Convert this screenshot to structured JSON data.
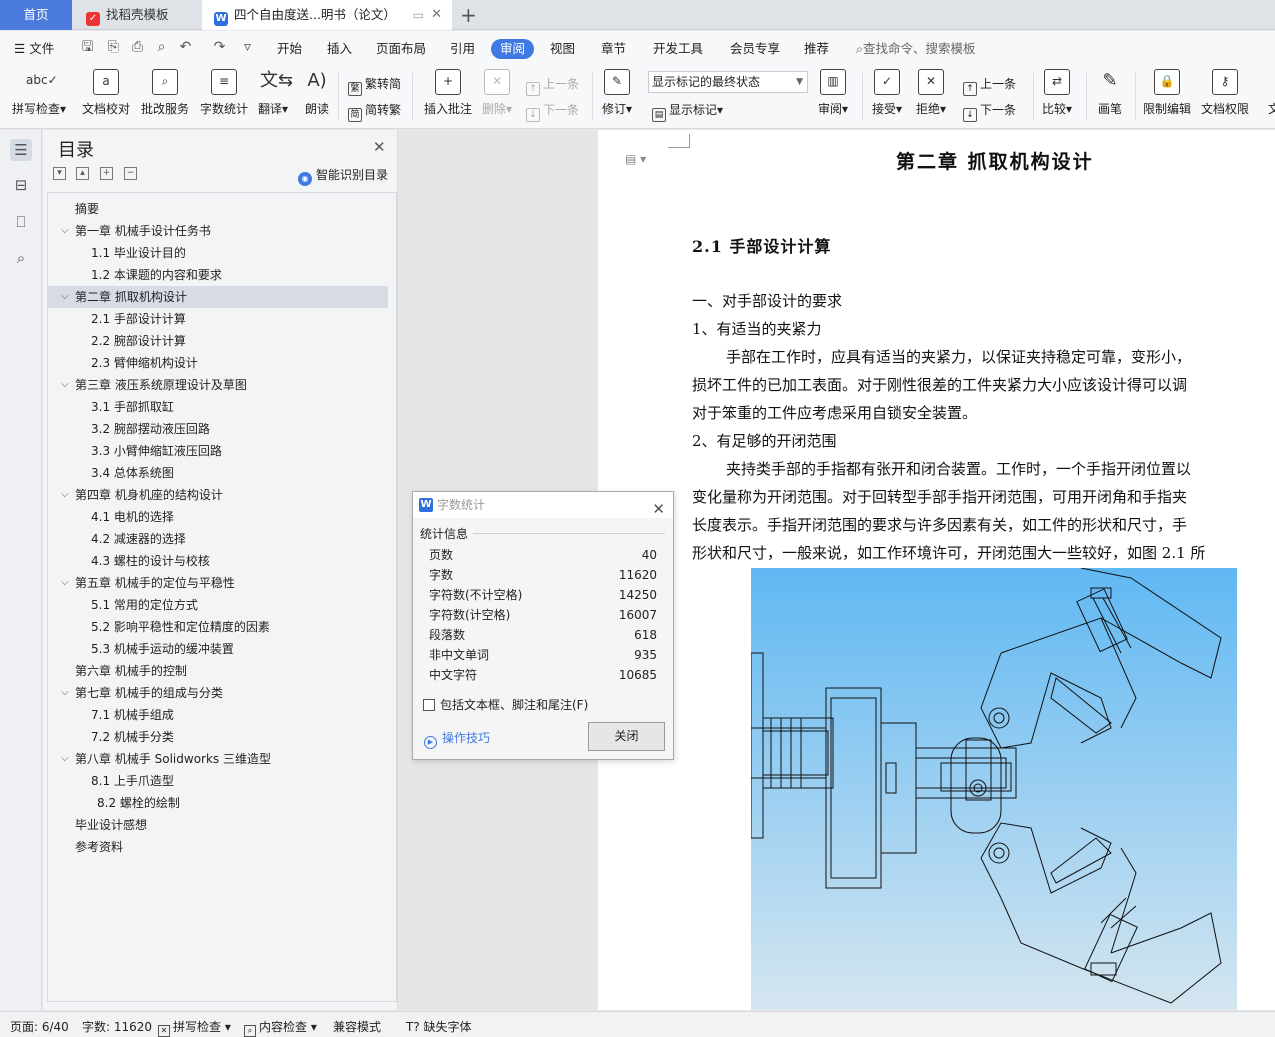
{
  "tabs": {
    "home": "首页",
    "template": "找稻壳模板",
    "document": "四个自由度送...明书（论文）"
  },
  "menu": {
    "file": "文件",
    "items": [
      "开始",
      "插入",
      "页面布局",
      "引用",
      "审阅",
      "视图",
      "章节",
      "开发工具",
      "会员专享",
      "推荐"
    ],
    "active": "审阅",
    "search": "查找命令、搜索模板"
  },
  "ribbon": {
    "spell_check": "拼写检查",
    "doc_proof": "文档校对",
    "batch_service": "批改服务",
    "word_count": "字数统计",
    "translate": "翻译",
    "read_aloud": "朗读",
    "trad_convert": "繁转简",
    "simp_convert": "简转繁",
    "insert_comment": "插入批注",
    "delete": "删除",
    "prev_item": "上一条",
    "next_item": "下一条",
    "revise": "修订",
    "markup_select": "显示标记的最终状态",
    "show_markup": "显示标记",
    "review": "审阅",
    "accept": "接受",
    "reject": "拒绝",
    "prev_change": "上一条",
    "next_change": "下一条",
    "compare": "比较",
    "ink": "画笔",
    "restrict_edit": "限制编辑",
    "doc_permission": "文档权限",
    "cut_off": "文"
  },
  "toc": {
    "title": "目录",
    "smart": "智能识别目录",
    "items": [
      {
        "label": "摘要",
        "level": 1,
        "caret": false
      },
      {
        "label": "第一章  机械手设计任务书",
        "level": 1,
        "caret": true
      },
      {
        "label": "1.1 毕业设计目的",
        "level": 2,
        "caret": false
      },
      {
        "label": "1.2 本课题的内容和要求",
        "level": 2,
        "caret": false
      },
      {
        "label": "第二章  抓取机构设计",
        "level": 1,
        "caret": true
      },
      {
        "label": "2.1 手部设计计算",
        "level": 2,
        "caret": false
      },
      {
        "label": "2.2 腕部设计计算",
        "level": 2,
        "caret": false
      },
      {
        "label": "2.3 臂伸缩机构设计",
        "level": 2,
        "caret": false
      },
      {
        "label": "第三章  液压系统原理设计及草图",
        "level": 1,
        "caret": true
      },
      {
        "label": "3.1 手部抓取缸",
        "level": 2,
        "caret": false
      },
      {
        "label": "3.2 腕部摆动液压回路",
        "level": 2,
        "caret": false
      },
      {
        "label": "3.3 小臂伸缩缸液压回路",
        "level": 2,
        "caret": false
      },
      {
        "label": "3.4 总体系统图",
        "level": 2,
        "caret": false
      },
      {
        "label": "第四章  机身机座的结构设计",
        "level": 1,
        "caret": true
      },
      {
        "label": "4.1 电机的选择",
        "level": 2,
        "caret": false
      },
      {
        "label": "4.2 减速器的选择",
        "level": 2,
        "caret": false
      },
      {
        "label": "4.3 螺柱的设计与校核",
        "level": 2,
        "caret": false
      },
      {
        "label": "第五章  机械手的定位与平稳性",
        "level": 1,
        "caret": true
      },
      {
        "label": "5.1 常用的定位方式",
        "level": 2,
        "caret": false
      },
      {
        "label": "5.2 影响平稳性和定位精度的因素",
        "level": 2,
        "caret": false
      },
      {
        "label": "5.3 机械手运动的缓冲装置",
        "level": 2,
        "caret": false
      },
      {
        "label": "第六章  机械手的控制",
        "level": 1,
        "caret": false
      },
      {
        "label": "第七章  机械手的组成与分类",
        "level": 1,
        "caret": true
      },
      {
        "label": "7.1 机械手组成",
        "level": 2,
        "caret": false
      },
      {
        "label": "7.2 机械手分类",
        "level": 2,
        "caret": false
      },
      {
        "label": "第八章  机械手 Solidworks 三维造型",
        "level": 1,
        "caret": true
      },
      {
        "label": "8.1 上手爪造型",
        "level": 2,
        "caret": false
      },
      {
        "label": "8.2 螺栓的绘制",
        "level": 3,
        "caret": false
      },
      {
        "label": "毕业设计感想",
        "level": 1,
        "caret": false
      },
      {
        "label": "参考资料",
        "level": 1,
        "caret": false
      }
    ],
    "selected_index": 4
  },
  "document": {
    "chapter_title": "第二章  抓取机构设计",
    "section_title": "2.1 手部设计计算",
    "lines": [
      "一、对手部设计的要求",
      "1、有适当的夹紧力",
      "手部在工作时，应具有适当的夹紧力，以保证夹持稳定可靠，变形小，",
      "损坏工件的已加工表面。对于刚性很差的工件夹紧力大小应该设计得可以调",
      "对于笨重的工件应考虑采用自锁安全装置。",
      "2、有足够的开闭范围",
      "夹持类手部的手指都有张开和闭合装置。工作时，一个手指开闭位置以",
      "变化量称为开闭范围。对于回转型手部手指开闭范围，可用开闭角和手指夹",
      "长度表示。手指开闭范围的要求与许多因素有关，如工件的形状和尺寸，手",
      "形状和尺寸，一般来说，如工作环境许可，开闭范围大一些较好，如图 2.1 所"
    ]
  },
  "word_count_dialog": {
    "title": "字数统计",
    "section": "统计信息",
    "rows": [
      {
        "label": "页数",
        "value": "40"
      },
      {
        "label": "字数",
        "value": "11620"
      },
      {
        "label": "字符数(不计空格)",
        "value": "14250"
      },
      {
        "label": "字符数(计空格)",
        "value": "16007"
      },
      {
        "label": "段落数",
        "value": "618"
      },
      {
        "label": "非中文单词",
        "value": "935"
      },
      {
        "label": "中文字符",
        "value": "10685"
      }
    ],
    "include_label": "包括文本框、脚注和尾注(F)",
    "tips": "操作技巧",
    "close": "关闭"
  },
  "status": {
    "page": "页面: 6/40",
    "words": "字数: 11620",
    "spell": "拼写检查",
    "content": "内容检查",
    "compat": "兼容模式",
    "missing_font": "缺失字体"
  },
  "colors": {
    "accent": "#3e7ae2",
    "home_tab": "#4b7bdc",
    "figure_top": "#60b8f3",
    "figure_bottom": "#d5e6f0"
  }
}
